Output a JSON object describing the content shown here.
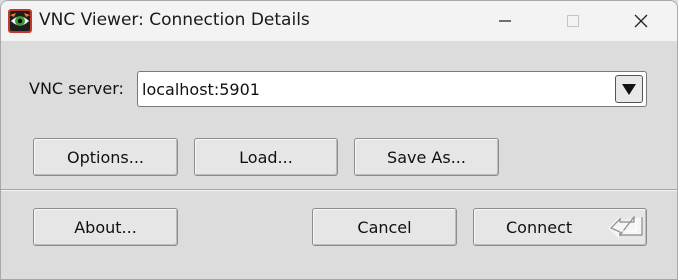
{
  "window": {
    "title": "VNC Viewer: Connection Details"
  },
  "titlebar": {
    "icons": {
      "app": "vnc-eye-icon",
      "minimize": "minimize-icon",
      "maximize": "maximize-icon",
      "close": "close-icon"
    }
  },
  "form": {
    "server_label": "VNC server:",
    "server_value": "localhost:5901",
    "dropdown_icon": "chevron-down-icon"
  },
  "buttons": {
    "options": "Options...",
    "load": "Load...",
    "save_as": "Save As...",
    "about": "About...",
    "cancel": "Cancel",
    "connect": "Connect",
    "connect_icon": "enter-key-icon"
  },
  "colors": {
    "background": "#dcdcdc",
    "titlebar": "#f3f3f3",
    "button_face": "#e6e6e6",
    "input_bg": "#ffffff"
  }
}
